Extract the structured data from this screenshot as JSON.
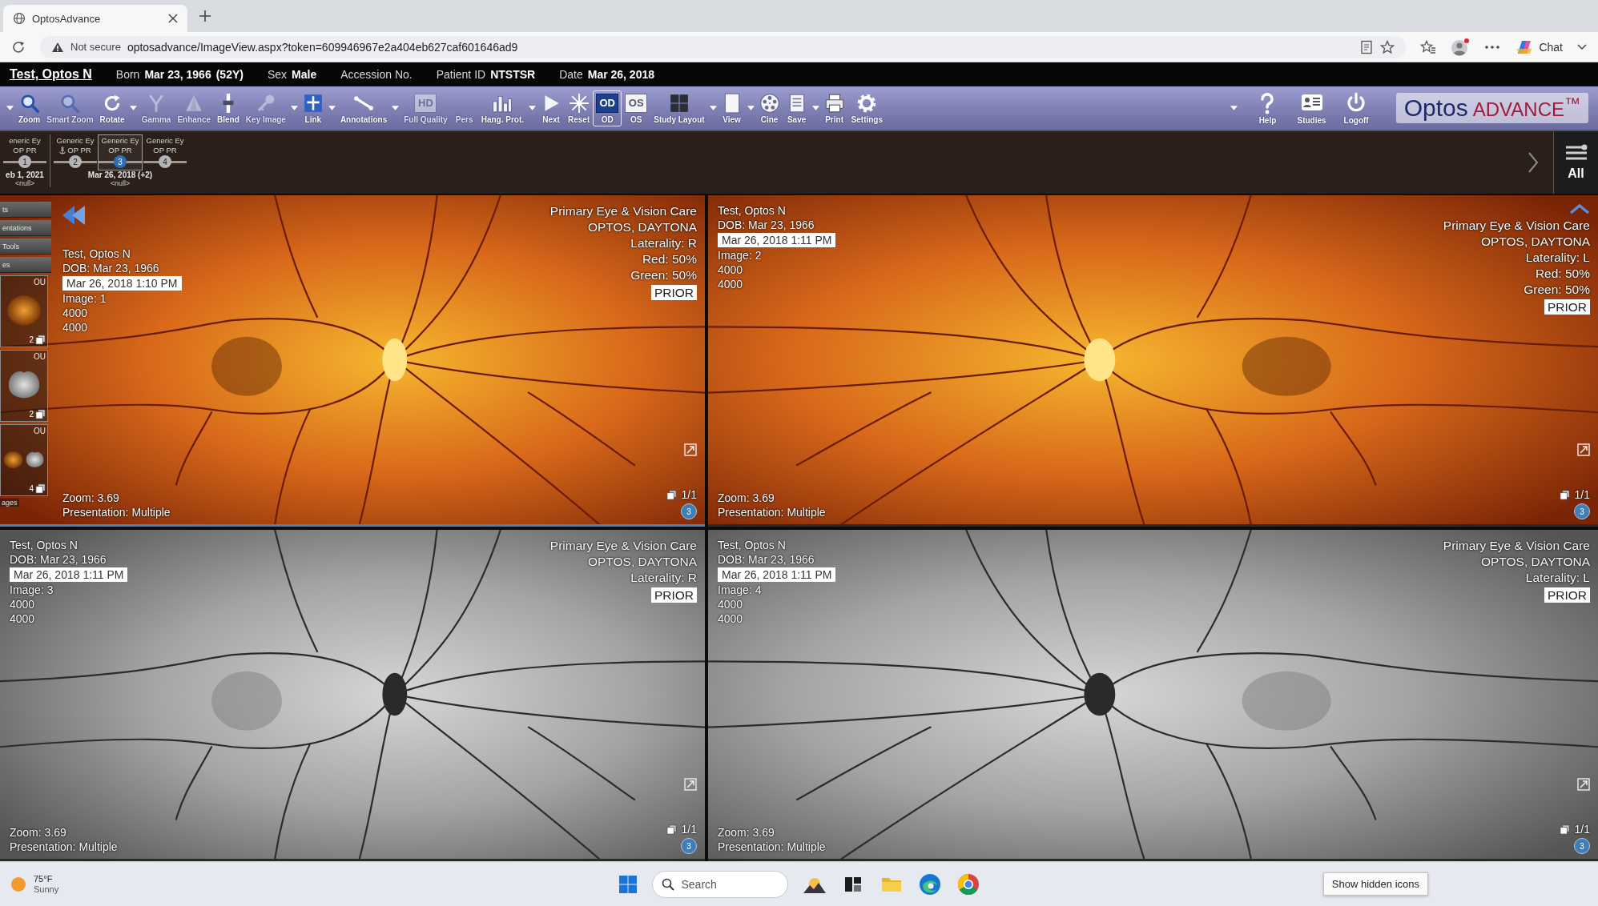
{
  "browser": {
    "tab": {
      "title": "OptosAdvance"
    },
    "address": {
      "security": "Not secure",
      "url": "optosadvance/ImageView.aspx?token=609946967e2a404eb627caf601646ad9"
    },
    "chat": {
      "label": "Chat"
    }
  },
  "header": {
    "patient_name": "Test, Optos N",
    "fields": [
      {
        "label": "Born",
        "value": "Mar 23, 1966",
        "extra": "(52Y)"
      },
      {
        "label": "Sex",
        "value": "Male"
      },
      {
        "label": "Accession No."
      },
      {
        "label": "Patient ID",
        "value": "NTSTSR"
      },
      {
        "label": "Date",
        "value": "Mar 26, 2018"
      }
    ]
  },
  "toolbar": {
    "menu_caret": true,
    "tools": [
      {
        "label": "Zoom",
        "disabled": false,
        "selected": false,
        "dropdown": false
      },
      {
        "label": "Smart Zoom",
        "disabled": true,
        "selected": false,
        "dropdown": false
      },
      {
        "label": "Rotate",
        "disabled": false,
        "selected": false,
        "dropdown": true
      },
      {
        "label": "Gamma",
        "disabled": true,
        "selected": false,
        "dropdown": false
      },
      {
        "label": "Enhance",
        "disabled": true,
        "selected": false,
        "dropdown": false
      },
      {
        "label": "Blend",
        "disabled": false,
        "selected": false,
        "dropdown": false
      },
      {
        "label": "Key Image",
        "disabled": true,
        "selected": false,
        "dropdown": true
      },
      {
        "label": "Link",
        "disabled": false,
        "selected": false,
        "dropdown": true
      },
      {
        "label": "Annotations",
        "disabled": false,
        "selected": false,
        "dropdown": true
      },
      {
        "label": "Full Quality",
        "badge": "HD",
        "disabled": true,
        "selected": false,
        "dropdown": false
      },
      {
        "label": "Pers",
        "disabled": true,
        "selected": false,
        "dropdown": false
      },
      {
        "label": "Hang. Prot.",
        "disabled": false,
        "selected": false,
        "dropdown": true
      },
      {
        "label": "Next",
        "disabled": false,
        "selected": false,
        "dropdown": false
      },
      {
        "label": "Reset",
        "disabled": false,
        "selected": false,
        "dropdown": false
      },
      {
        "label": "OD",
        "badge": "OD",
        "disabled": false,
        "selected": true,
        "dropdown": false
      },
      {
        "label": "OS",
        "badge": "OS",
        "disabled": false,
        "selected": false,
        "dropdown": false
      },
      {
        "label": "Study Layout",
        "disabled": false,
        "selected": false,
        "dropdown": true
      },
      {
        "label": "View",
        "disabled": false,
        "selected": false,
        "dropdown": true
      },
      {
        "label": "Cine",
        "disabled": false,
        "selected": false,
        "dropdown": false
      },
      {
        "label": "Save",
        "disabled": false,
        "selected": false,
        "dropdown": true
      },
      {
        "label": "Print",
        "disabled": false,
        "selected": false,
        "dropdown": false
      },
      {
        "label": "Settings",
        "disabled": false,
        "selected": false,
        "dropdown": false
      }
    ],
    "right_caret": true,
    "right_tools": [
      {
        "label": "Help"
      },
      {
        "label": "Studies"
      },
      {
        "label": "Logoff"
      }
    ],
    "logo": {
      "name": "Optos",
      "suffix": "ADVANCE$^{™}$"
    }
  },
  "timeline": {
    "groups": [
      {
        "date": "eb 1, 2021",
        "note": "<null>",
        "nodes": [
          {
            "label": "eneric Ey",
            "sub": "OP PR",
            "number": "1",
            "anchor": false,
            "selected": false
          }
        ]
      },
      {
        "date": "Mar 26, 2018 (+2)",
        "note": "<null>",
        "nodes": [
          {
            "label": "Generic Ey",
            "sub": "OP PR",
            "number": "2",
            "anchor": true,
            "selected": false
          },
          {
            "label": "Generic Ey",
            "sub": "OP PR",
            "number": "3",
            "anchor": false,
            "selected": true
          },
          {
            "label": "Generic Ey",
            "sub": "OP PR",
            "number": "4",
            "anchor": false,
            "selected": false
          }
        ]
      }
    ],
    "all_label": "All"
  },
  "sidebar": {
    "buttons": [
      "ts",
      "entations",
      "Tools",
      "es"
    ],
    "thumbnails": [
      {
        "kind": "color",
        "laterality": "OU",
        "count": "2"
      },
      {
        "kind": "grey",
        "laterality": "OU",
        "count": "2"
      },
      {
        "kind": "split",
        "laterality": "OU",
        "count": "4"
      }
    ],
    "footer": "ages"
  },
  "viewports": [
    {
      "kind": "color",
      "selected": true,
      "patient": "Test, Optos N",
      "dob": "DOB: Mar 23, 1966",
      "acquired": "Mar 26, 2018 1:10 PM",
      "image": "Image: 1",
      "dims": [
        "4000",
        "4000"
      ],
      "site": [
        "Primary Eye & Vision Care",
        "OPTOS, DAYTONA",
        "Laterality: R",
        "Red: 50%",
        "Green: 50%"
      ],
      "tag": "PRIOR",
      "zoom": "Zoom: 3.69",
      "presentation": "Presentation: Multiple",
      "frames": "1/1",
      "count": "3"
    },
    {
      "kind": "color",
      "selected": false,
      "patient": "Test, Optos N",
      "dob": "DOB: Mar 23, 1966",
      "acquired": "Mar 26, 2018 1:11 PM",
      "image": "Image: 2",
      "dims": [
        "4000",
        "4000"
      ],
      "site": [
        "Primary Eye & Vision Care",
        "OPTOS, DAYTONA",
        "Laterality: L",
        "Red: 50%",
        "Green: 50%"
      ],
      "tag": "PRIOR",
      "zoom": "Zoom: 3.69",
      "presentation": "Presentation: Multiple",
      "frames": "1/1",
      "count": "3"
    },
    {
      "kind": "grey",
      "selected": false,
      "patient": "Test, Optos N",
      "dob": "DOB: Mar 23, 1966",
      "acquired": "Mar 26, 2018 1:11 PM",
      "image": "Image: 3",
      "dims": [
        "4000",
        "4000"
      ],
      "site": [
        "Primary Eye & Vision Care",
        "OPTOS, DAYTONA",
        "Laterality: R"
      ],
      "tag": "PRIOR",
      "zoom": "Zoom: 3.69",
      "presentation": "Presentation: Multiple",
      "frames": "1/1",
      "count": "3"
    },
    {
      "kind": "grey",
      "selected": false,
      "patient": "Test, Optos N",
      "dob": "DOB: Mar 23, 1966",
      "acquired": "Mar 26, 2018 1:11 PM",
      "image": "Image: 4",
      "dims": [
        "4000",
        "4000"
      ],
      "site": [
        "Primary Eye & Vision Care",
        "OPTOS, DAYTONA",
        "Laterality: L"
      ],
      "tag": "PRIOR",
      "zoom": "Zoom: 3.69",
      "presentation": "Presentation: Multiple",
      "frames": "1/1",
      "count": "3"
    }
  ],
  "taskbar": {
    "weather": {
      "temperature": "75°F",
      "condition": "Sunny"
    },
    "search": {
      "placeholder": "Search"
    },
    "tooltip": "Show hidden icons"
  }
}
